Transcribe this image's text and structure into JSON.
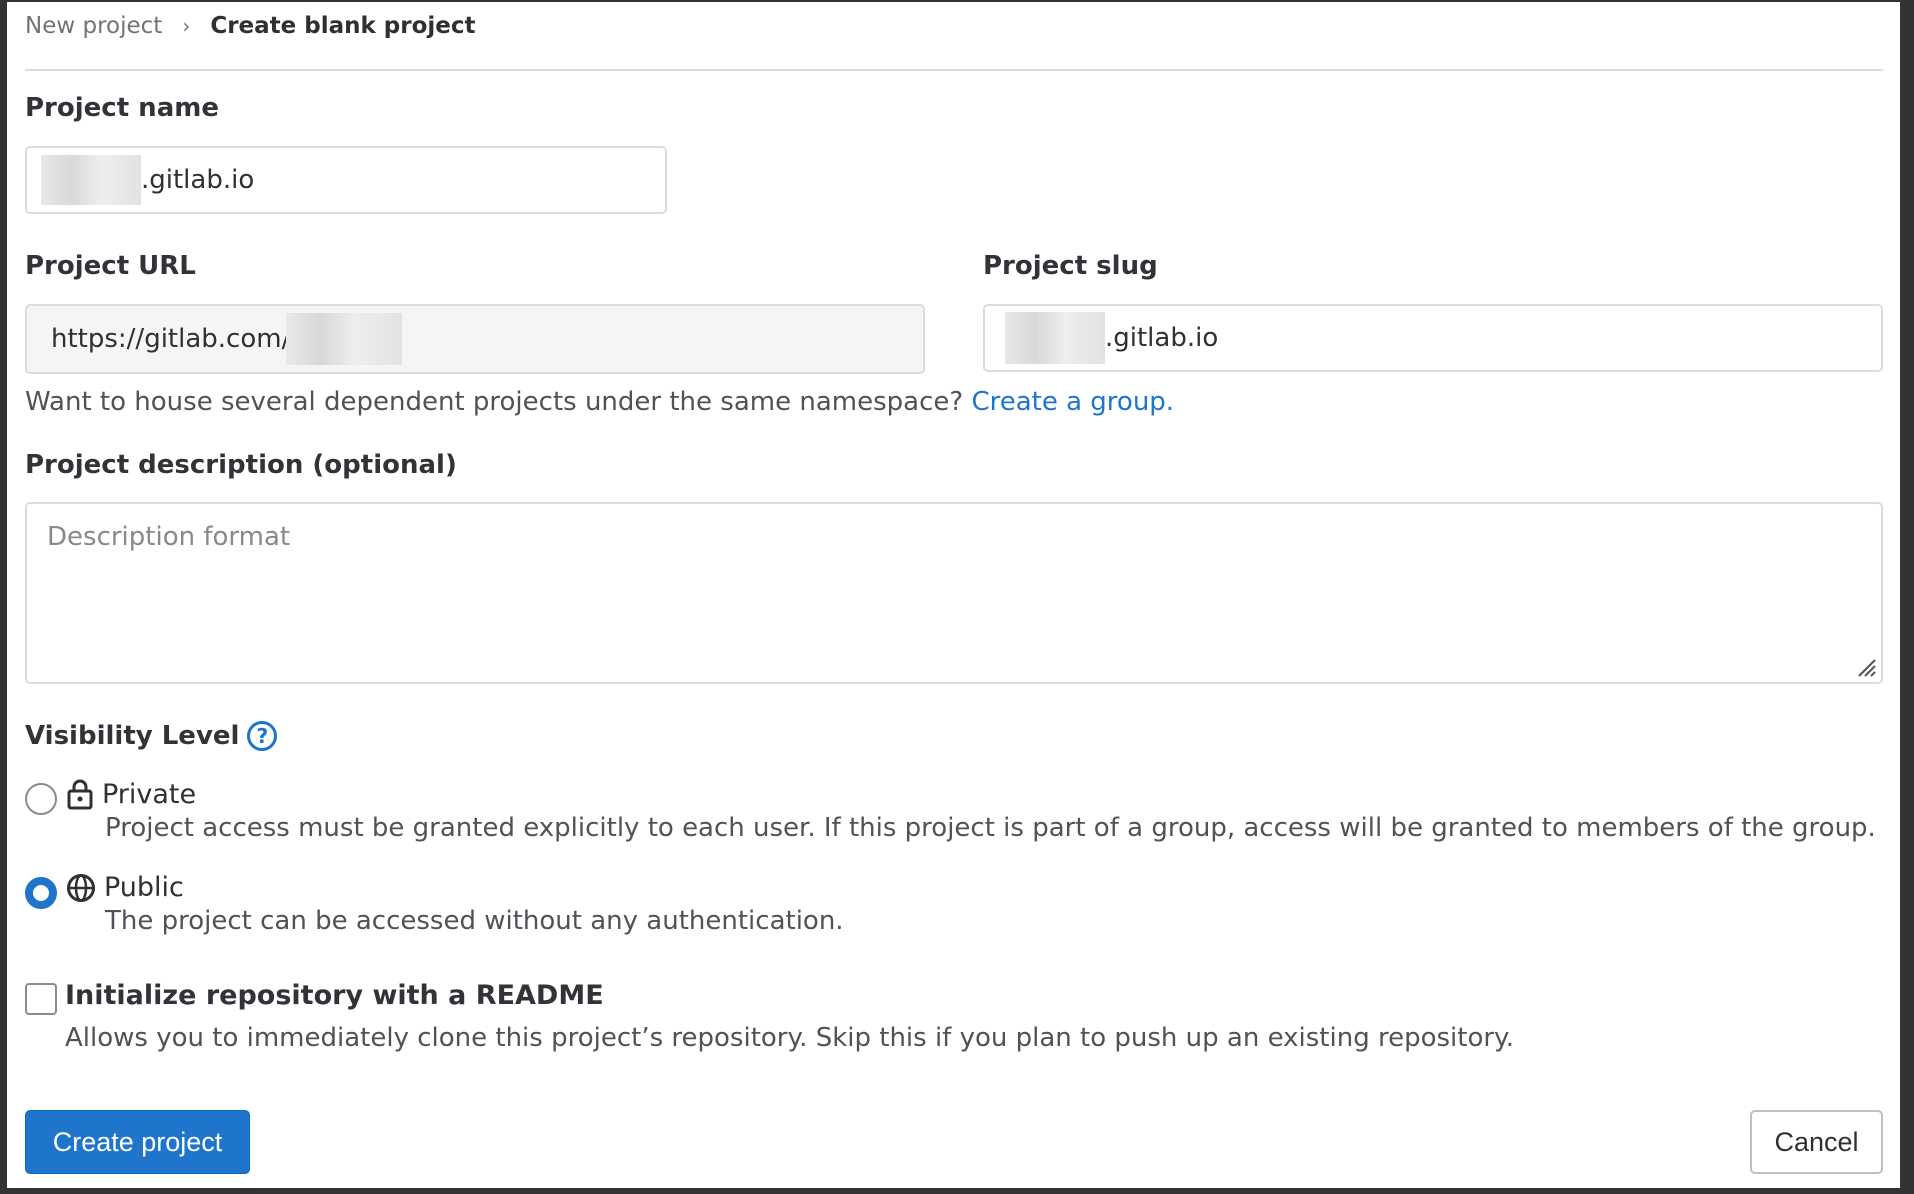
{
  "breadcrumb": {
    "parent": "New project",
    "current": "Create blank project"
  },
  "project_name": {
    "label": "Project name",
    "value_suffix": ".gitlab.io"
  },
  "project_url": {
    "label": "Project URL",
    "value_prefix": "https://gitlab.com/"
  },
  "project_slug": {
    "label": "Project slug",
    "value_suffix": ".gitlab.io"
  },
  "group_hint": {
    "text": "Want to house several dependent projects under the same namespace?",
    "link": "Create a group."
  },
  "description": {
    "label": "Project description (optional)",
    "placeholder": "Description format"
  },
  "visibility": {
    "label": "Visibility Level",
    "help_icon": "question-circle-icon",
    "options": [
      {
        "label": "Private",
        "icon": "lock-icon",
        "description": "Project access must be granted explicitly to each user. If this project is part of a group, access will be granted to members of the group.",
        "checked": false
      },
      {
        "label": "Public",
        "icon": "globe-icon",
        "description": "The project can be accessed without any authentication.",
        "checked": true
      }
    ]
  },
  "readme": {
    "label": "Initialize repository with a README",
    "description": "Allows you to immediately clone this project’s repository. Skip this if you plan to push up an existing repository.",
    "checked": false
  },
  "actions": {
    "create": "Create project",
    "cancel": "Cancel"
  },
  "colors": {
    "primary": "#1f75cb",
    "frame": "#333333"
  }
}
